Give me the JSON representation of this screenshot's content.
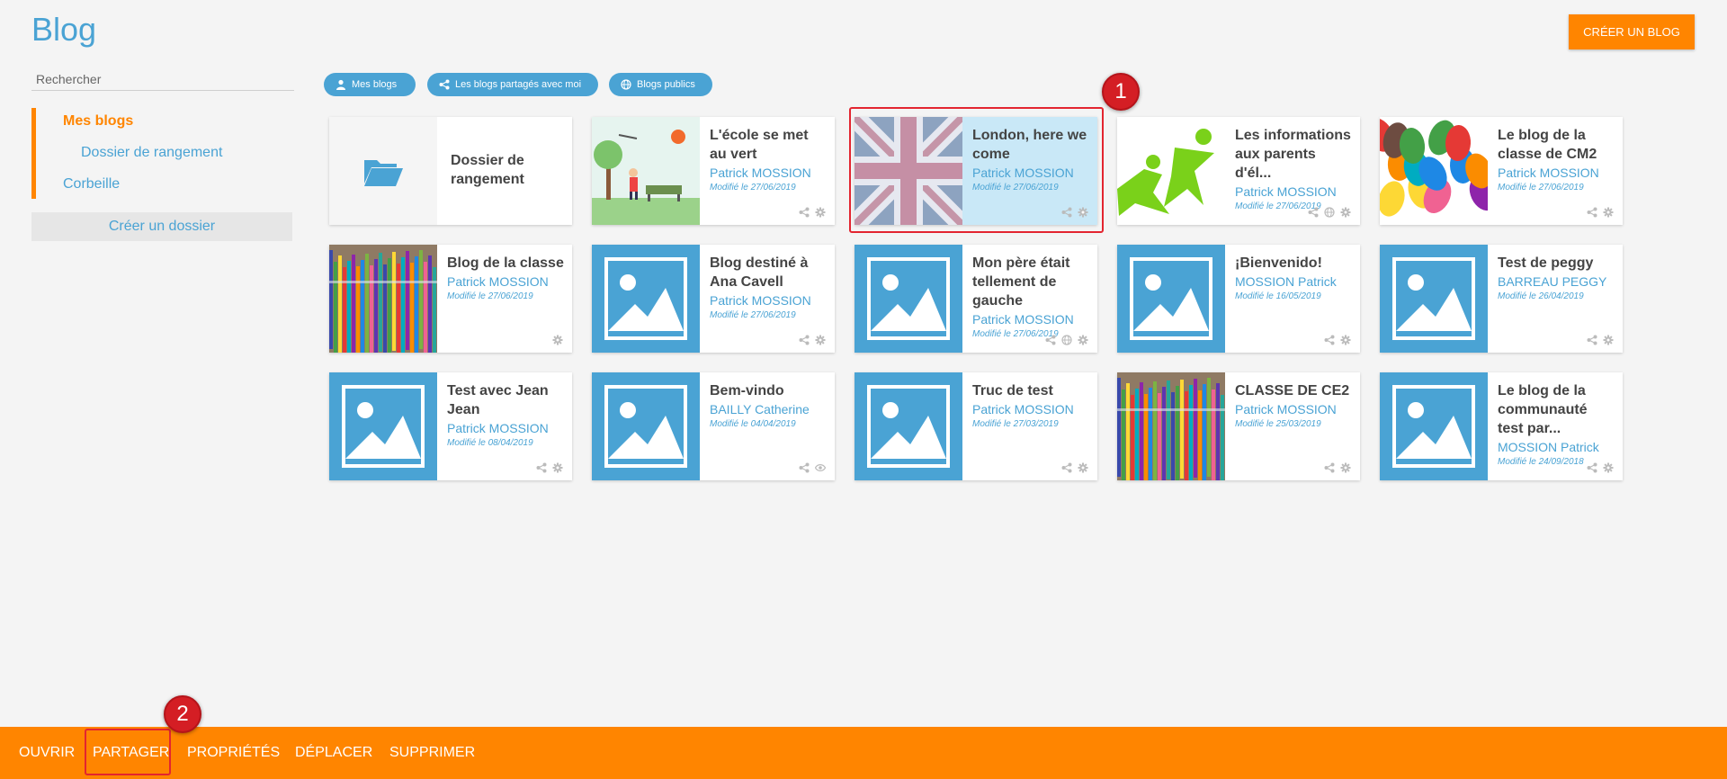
{
  "header": {
    "title": "Blog",
    "create_button": "Créer un blog"
  },
  "sidebar": {
    "search_placeholder": "Rechercher",
    "items": [
      {
        "label": "Mes blogs",
        "active": true
      },
      {
        "label": "Dossier de rangement",
        "active": false
      },
      {
        "label": "Corbeille",
        "active": false
      }
    ],
    "create_folder": "Créer un dossier"
  },
  "filters": [
    {
      "label": "Mes blogs",
      "icon": "user-icon"
    },
    {
      "label": "Les blogs partagés avec moi",
      "icon": "share-icon"
    },
    {
      "label": "Blogs publics",
      "icon": "globe-icon"
    }
  ],
  "folder": {
    "title": "Dossier de rangement",
    "icon": "folder-icon"
  },
  "blogs": [
    {
      "title": "L'école se met au vert",
      "owner": "Patrick MOSSION",
      "date": "Modifié le 27/06/2019",
      "thumb": "school-illustration",
      "icons": [
        "share-icon",
        "gear-icon"
      ]
    },
    {
      "title": "London, here we come",
      "owner": "Patrick MOSSION",
      "date": "Modifié le 27/06/2019",
      "thumb": "uk-flag",
      "icons": [
        "share-icon",
        "gear-icon"
      ],
      "selected": true
    },
    {
      "title": "Les informations aux parents d'él...",
      "owner": "Patrick MOSSION",
      "date": "Modifié le 27/06/2019",
      "thumb": "green-figures",
      "icons": [
        "share-icon",
        "globe-icon",
        "gear-icon"
      ]
    },
    {
      "title": "Le blog de la classe de CM2",
      "owner": "Patrick MOSSION",
      "date": "Modifié le 27/06/2019",
      "thumb": "colorful-hands",
      "icons": [
        "share-icon",
        "gear-icon"
      ]
    },
    {
      "title": "Blog de la classe",
      "owner": "Patrick MOSSION",
      "date": "Modifié le 27/06/2019",
      "thumb": "colored-pencils",
      "icons": [
        "gear-icon"
      ]
    },
    {
      "title": "Blog destiné à Ana Cavell",
      "owner": "Patrick MOSSION",
      "date": "Modifié le 27/06/2019",
      "thumb": "placeholder",
      "icons": [
        "share-icon",
        "gear-icon"
      ]
    },
    {
      "title": "Mon père était tellement de gauche",
      "owner": "Patrick MOSSION",
      "date": "Modifié le 27/06/2019",
      "thumb": "placeholder",
      "icons": [
        "share-icon",
        "globe-icon",
        "gear-icon"
      ]
    },
    {
      "title": "¡Bienvenido!",
      "owner": "MOSSION Patrick",
      "date": "Modifié le 16/05/2019",
      "thumb": "placeholder",
      "icons": [
        "share-icon",
        "gear-icon"
      ]
    },
    {
      "title": "Test de peggy",
      "owner": "BARREAU PEGGY",
      "date": "Modifié le 26/04/2019",
      "thumb": "placeholder",
      "icons": [
        "share-icon",
        "gear-icon"
      ]
    },
    {
      "title": "Test avec Jean Jean",
      "owner": "Patrick MOSSION",
      "date": "Modifié le 08/04/2019",
      "thumb": "placeholder",
      "icons": [
        "share-icon",
        "gear-icon"
      ]
    },
    {
      "title": "Bem-vindo",
      "owner": "BAILLY Catherine",
      "date": "Modifié le 04/04/2019",
      "thumb": "placeholder",
      "icons": [
        "share-icon",
        "eye-icon"
      ]
    },
    {
      "title": "Truc de test",
      "owner": "Patrick MOSSION",
      "date": "Modifié le 27/03/2019",
      "thumb": "placeholder",
      "icons": [
        "share-icon",
        "gear-icon"
      ]
    },
    {
      "title": "CLASSE DE CE2",
      "owner": "Patrick MOSSION",
      "date": "Modifié le 25/03/2019",
      "thumb": "colored-pencils",
      "icons": [
        "share-icon",
        "gear-icon"
      ]
    },
    {
      "title": "Le blog de la communauté test par...",
      "owner": "MOSSION Patrick",
      "date": "Modifié le 24/09/2018",
      "thumb": "placeholder",
      "icons": [
        "share-icon",
        "gear-icon"
      ]
    }
  ],
  "annotations": [
    "1",
    "2"
  ],
  "bottom_actions": [
    "Ouvrir",
    "Partager",
    "Propriétés",
    "Déplacer",
    "Supprimer"
  ],
  "colors": {
    "accent": "#ff8500",
    "primary": "#4aa3d4",
    "highlight": "#e32530"
  }
}
